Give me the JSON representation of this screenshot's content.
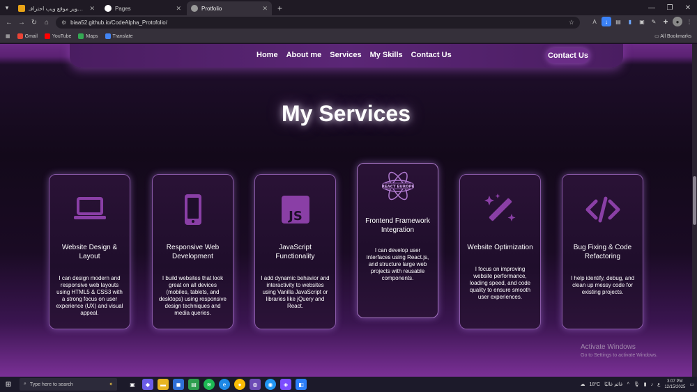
{
  "browser": {
    "tabs": [
      {
        "title": "تصميم وتطوير موقع ويب احترافـ",
        "fav_color": "#e8a317",
        "active": false
      },
      {
        "title": "Pages",
        "fav_color": "#ffffff",
        "active": false
      },
      {
        "title": "Protfolio",
        "fav_color": "#9a9a9a",
        "active": true
      }
    ],
    "new_tab": "+",
    "url": "biaa52.github.io/CodeAlpha_Protofolio/",
    "bookmarks": [
      {
        "label": "Gmail",
        "color": "#ea4335"
      },
      {
        "label": "YouTube",
        "color": "#ff0000"
      },
      {
        "label": "Maps",
        "color": "#34a853"
      },
      {
        "label": "Translate",
        "color": "#4285f4"
      }
    ],
    "all_bookmarks": "All Bookmarks"
  },
  "nav": {
    "links": [
      "Home",
      "About me",
      "Services",
      "My Skills",
      "Contact Us"
    ],
    "cta": "Contact Us"
  },
  "section": {
    "title": "My Services",
    "cards": [
      {
        "icon": "laptop-icon",
        "title": "Website Design & Layout",
        "desc": "I can design modern and responsive web layouts using HTML5 & CSS3 with a strong focus on user experience (UX) and visual appeal."
      },
      {
        "icon": "mobile-icon",
        "title": "Responsive Web Development",
        "desc": "I build websites that look great on all devices (mobiles, tablets, and desktops) using responsive design techniques and media queries."
      },
      {
        "icon": "js-icon",
        "title": "JavaScript Functionality",
        "desc": "I add dynamic behavior and interactivity to websites using Vanilla JavaScript or libraries like jQuery and React."
      },
      {
        "icon": "react-icon",
        "title": "Frontend Framework Integration",
        "desc": "I can develop user interfaces using React.js, and structure large web projects with reusable components.",
        "icon_label": "REACT EUROPE"
      },
      {
        "icon": "magic-wand-icon",
        "title": "Website Optimization",
        "desc": "I focus on improving website performance, loading speed, and code quality to ensure smooth user experiences."
      },
      {
        "icon": "code-icon",
        "title": "Bug Fixing & Code Refactoring",
        "desc": "I help identify, debug, and clean up messy code for existing projects."
      }
    ]
  },
  "watermark": {
    "line1": "Activate Windows",
    "line2": "Go to Settings to activate Windows."
  },
  "taskbar": {
    "search_placeholder": "Type here to search",
    "weather": "18°C",
    "weather_label": "غائم غالبًا",
    "time": "3:07 PM",
    "date": "12/15/2025",
    "lang": "ع"
  },
  "colors": {
    "accent": "#6b2d88",
    "icon": "#8a3fa6"
  }
}
